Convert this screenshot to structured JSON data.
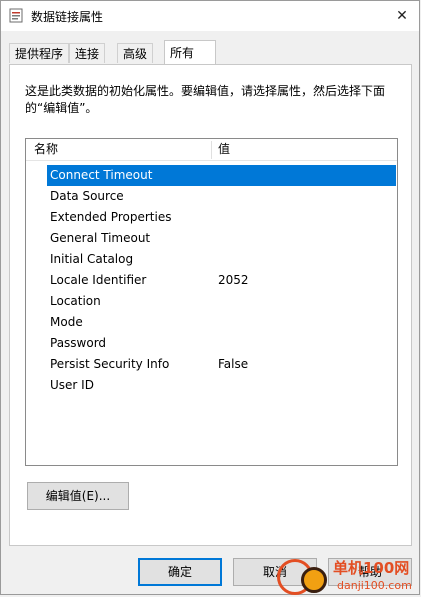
{
  "window": {
    "title": "数据链接属性",
    "close_glyph": "✕"
  },
  "tabs": [
    {
      "label": "提供程序"
    },
    {
      "label": "连接"
    },
    {
      "label": "高级"
    },
    {
      "label": "所有"
    }
  ],
  "panel": {
    "description": "这是此类数据的初始化属性。要编辑值，请选择属性，然后选择下面的“编辑值”。",
    "columns": {
      "name": "名称",
      "value": "值"
    },
    "rows": [
      {
        "name": "Connect Timeout",
        "value": ""
      },
      {
        "name": "Data Source",
        "value": ""
      },
      {
        "name": "Extended Properties",
        "value": ""
      },
      {
        "name": "General Timeout",
        "value": ""
      },
      {
        "name": "Initial Catalog",
        "value": ""
      },
      {
        "name": "Locale Identifier",
        "value": "2052"
      },
      {
        "name": "Location",
        "value": ""
      },
      {
        "name": "Mode",
        "value": ""
      },
      {
        "name": "Password",
        "value": ""
      },
      {
        "name": "Persist Security Info",
        "value": "False"
      },
      {
        "name": "User ID",
        "value": ""
      }
    ],
    "selected_row": "Connect Timeout",
    "edit_button": "编辑值(E)..."
  },
  "buttons": {
    "ok": "确定",
    "cancel": "取消",
    "help": "帮助"
  },
  "watermark": {
    "line1": "单机100网",
    "line2": "danji100.com"
  },
  "colors": {
    "selection": "#0078d7",
    "watermark": "#e34e23"
  }
}
